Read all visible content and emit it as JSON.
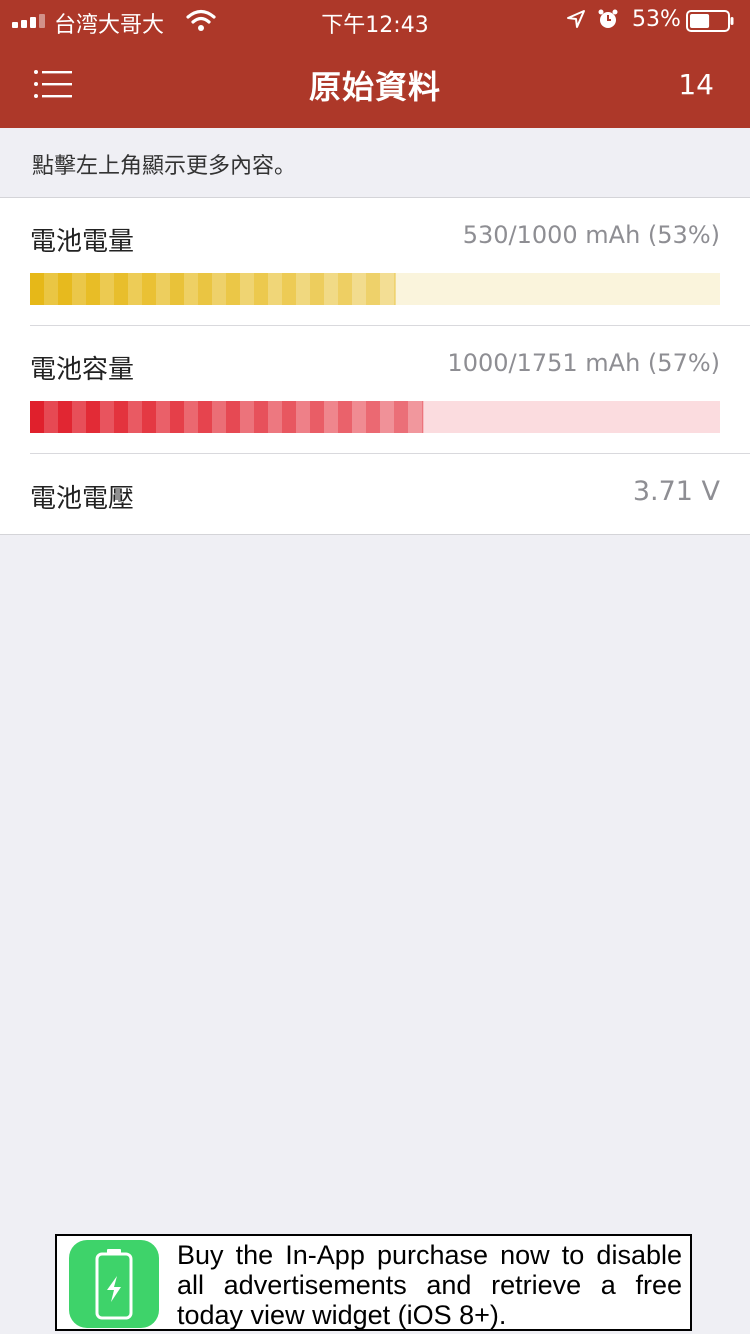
{
  "status_bar": {
    "carrier": "台湾大哥大",
    "time": "下午12:43",
    "battery_percent": "53%",
    "battery_level": 0.53
  },
  "nav": {
    "title": "原始資料",
    "count": "14"
  },
  "hint": "點擊左上角顯示更多內容。",
  "rows": [
    {
      "label": "電池電量",
      "value": "530/1000 mAh (53%)",
      "fraction": 0.53,
      "color": "#e6b818",
      "track": "#faf4dc"
    },
    {
      "label": "電池容量",
      "value": "1000/1751 mAh (57%)",
      "fraction": 0.57,
      "color": "#e0202c",
      "track": "#fbdcdf"
    },
    {
      "label": "電池電壓",
      "value": "3.71 V"
    }
  ],
  "ad": {
    "text": "Buy the In-App purchase now to disable all advertisements and retrieve a free today view widget (iOS 8+)."
  },
  "colors": {
    "accent": "#ad3829",
    "background": "#efeff4",
    "ad_green": "#3ed36a"
  }
}
